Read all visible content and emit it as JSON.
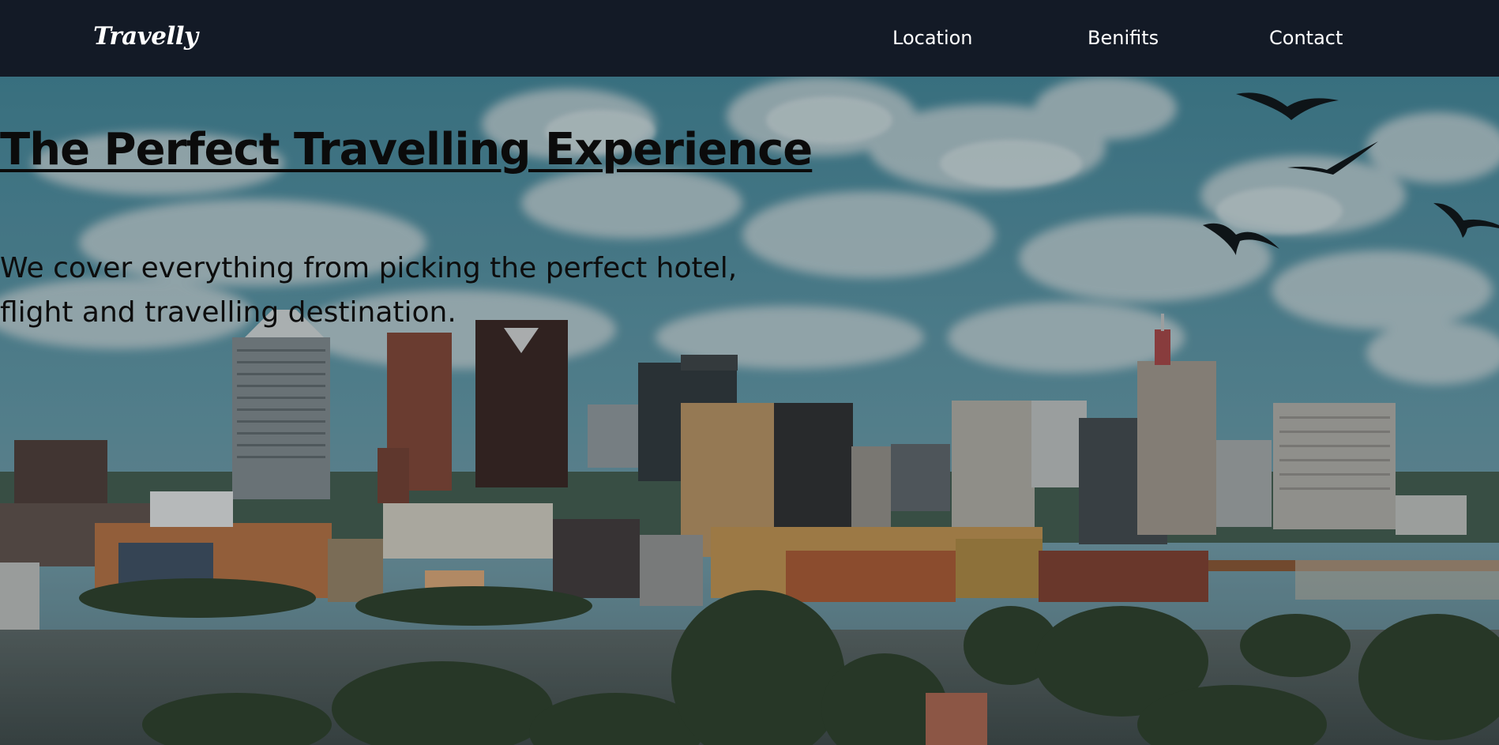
{
  "navbar": {
    "logo": "Travelly",
    "links": [
      {
        "label": "Location"
      },
      {
        "label": "Benifits"
      },
      {
        "label": "Contact"
      }
    ]
  },
  "hero": {
    "title": "The Perfect Travelling Experience",
    "description": "We cover everything from picking the perfect hotel, flight and travelling destination.",
    "image": "city-skyline-river-photo"
  },
  "colors": {
    "navbar_bg": "#131a26",
    "nav_text": "#ffffff",
    "hero_text": "#0b0b0b"
  }
}
